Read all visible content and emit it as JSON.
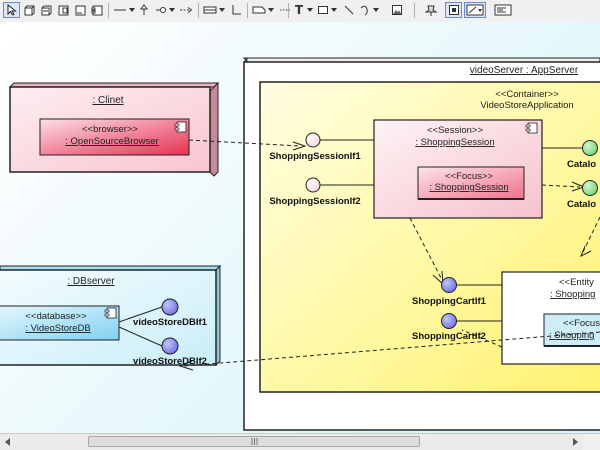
{
  "toolbar": {
    "text_tool_label": "T"
  },
  "diagram": {
    "nodes": {
      "client": {
        "name": ": Clinet"
      },
      "browser": {
        "stereotype": "<<browser>>",
        "name": ": OpenSourceBrowser"
      },
      "db_server": {
        "name": ": DBserver"
      },
      "database": {
        "stereotype": "<<database>>",
        "name": ": VideoStoreDB"
      },
      "video_server": {
        "name": "videoServer : AppServer"
      },
      "container": {
        "stereotype": "<<Container>>",
        "name": "VideoStoreApplication"
      },
      "session": {
        "stereotype": "<<Session>>",
        "name": ": ShoppingSession"
      },
      "focus_session": {
        "stereotype": "<<Focus>>",
        "name": ": ShoppingSession"
      },
      "entity": {
        "stereotype": "<<Entity",
        "name": ": Shopping"
      },
      "focus_entity": {
        "stereotype": "<<Focus",
        "name": ": Shopping"
      }
    },
    "interfaces": {
      "shopping_session_if1": "ShoppingSessionIf1",
      "shopping_session_if2": "ShoppingSessionIf2",
      "shopping_cart_if1": "ShoppingCartIf1",
      "shopping_cart_if2": "ShoppingCartIf2",
      "video_store_db_if1": "videoStoreDBIf1",
      "video_store_db_if2": "videoStoreDBIf2",
      "catalog_1": "Catalo",
      "catalog_2": "Catalo"
    }
  },
  "colors": {
    "node_pink": "#fbd3da",
    "artifact_pink": "#f07a92",
    "artifact_red": "#e8365a",
    "node_cyan": "#d8f4fb",
    "artifact_blue": "#9fdcf3",
    "container_yellow": "#fff899",
    "interface_pink": "#fde6ea",
    "interface_blue": "#8c8ff0",
    "interface_green": "#8fe08f"
  }
}
